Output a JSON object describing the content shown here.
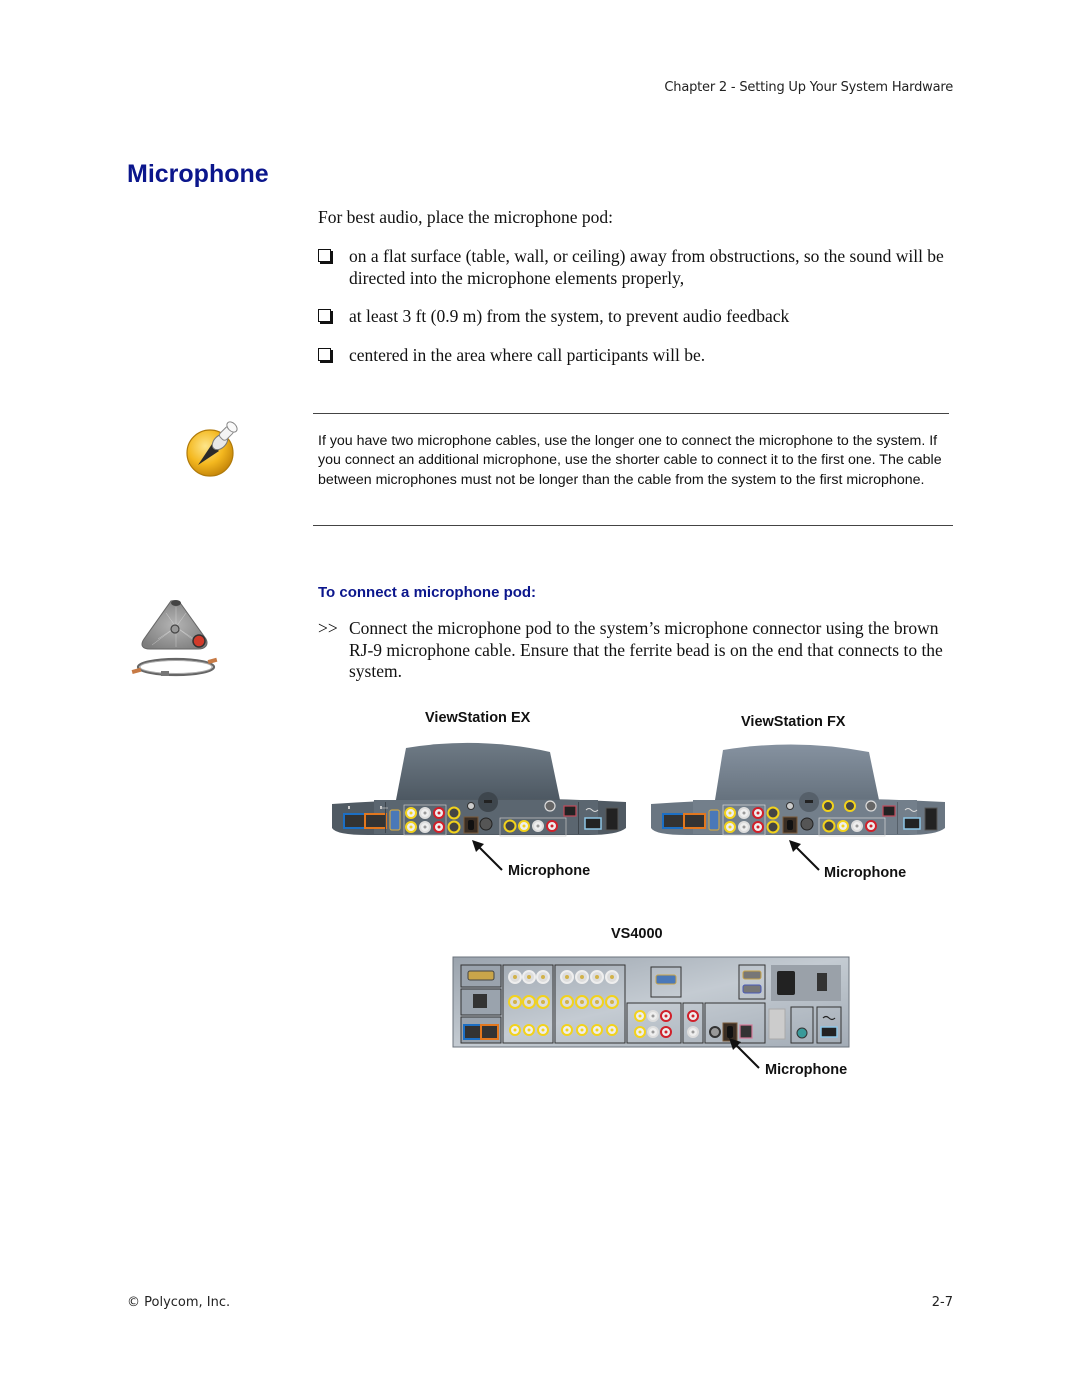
{
  "header": {
    "running_head": "Chapter 2 - Setting Up Your System Hardware"
  },
  "section": {
    "title": "Microphone",
    "intro": "For best audio, place the microphone pod:",
    "bullets": [
      "on a flat surface (table, wall, or ceiling) away from obstructions, so the sound will be directed into the microphone elements properly,",
      "at least 3 ft (0.9 m) from the system, to prevent audio feedback",
      "centered in the area where call participants will be."
    ],
    "bullet_icon": "checkbox-square-icon"
  },
  "note": {
    "icon": "pushpin-note-icon",
    "text": "If you have two microphone cables, use the longer one to connect the microphone to the system. If you connect an additional microphone, use the shorter cable to connect it to the first one. The cable between microphones must not be longer than the cable from the system to the first microphone."
  },
  "procedure": {
    "title": "To connect a microphone pod:",
    "step_marker": ">>",
    "step": "Connect the microphone pod to the system’s microphone connector using the brown RJ-9 microphone cable. Ensure that the ferrite bead is on the end that connects to the system.",
    "side_image": "microphone-pod-with-cable"
  },
  "figures": {
    "viewstation_ex": {
      "title": "ViewStation EX",
      "callout": "Microphone"
    },
    "viewstation_fx": {
      "title": "ViewStation FX",
      "callout": "Microphone"
    },
    "vs4000": {
      "title": "VS4000",
      "callout": "Microphone"
    }
  },
  "colors": {
    "heading_blue": "#0b168c",
    "lan_blue": "#1c6fc4",
    "lan_orange": "#e2771e",
    "rca_yellow": "#f2d21c",
    "rca_red": "#d0202a",
    "panel_gray": "#5f6670"
  },
  "footer": {
    "copyright": "© Polycom, Inc.",
    "page_number": "2-7"
  }
}
